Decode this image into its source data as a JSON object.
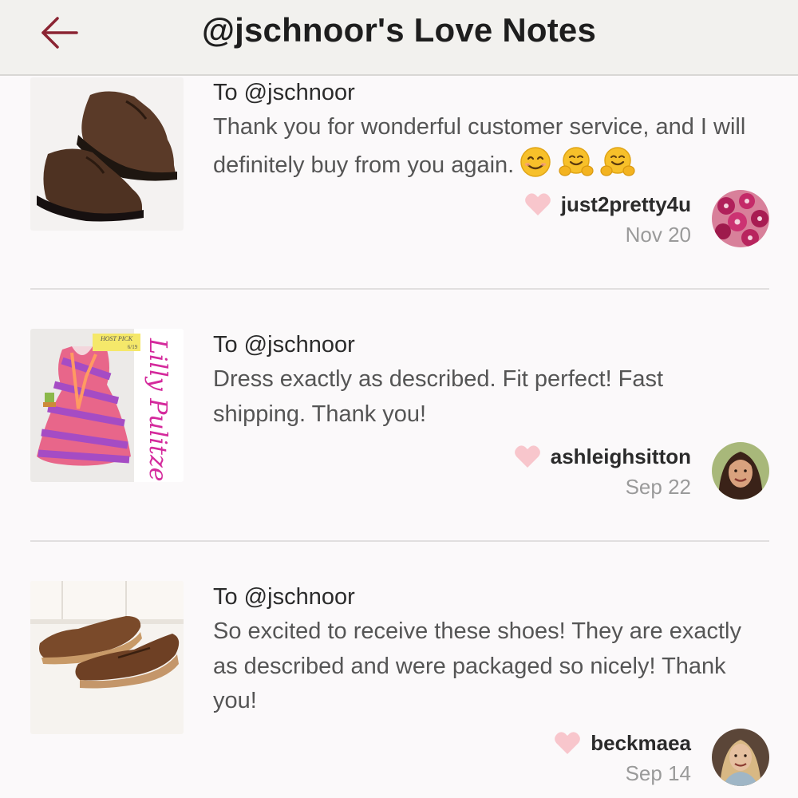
{
  "header": {
    "title": "@jschnoor's Love Notes"
  },
  "notes": [
    {
      "to": "To @jschnoor",
      "message": "Thank you for wonderful customer service, and I will definitely buy from you again.",
      "emojis": [
        "smiling-face",
        "hugging-face",
        "hugging-face"
      ],
      "username": "just2pretty4u",
      "date": "Nov 20"
    },
    {
      "to": "To @jschnoor",
      "message": "Dress exactly as described. Fit perfect! Fast shipping. Thank you!",
      "username": "ashleighsitton",
      "date": "Sep 22",
      "thumb_labels": {
        "badge": "HOST PICK",
        "badge_date": "6/19",
        "signature": "Lilly Pulitzer"
      }
    },
    {
      "to": "To @jschnoor",
      "message": "So excited to receive these shoes! They are exactly as described and were packaged so nicely! Thank you!",
      "username": "beckmaea",
      "date": "Sep 14"
    }
  ],
  "colors": {
    "back_arrow": "#8b2432",
    "heart": "#f8c6cc",
    "header_bg": "#f2f1ee",
    "page_bg": "#fbf9fa"
  },
  "icons": {
    "back": "back-arrow-icon",
    "heart": "heart-icon"
  }
}
